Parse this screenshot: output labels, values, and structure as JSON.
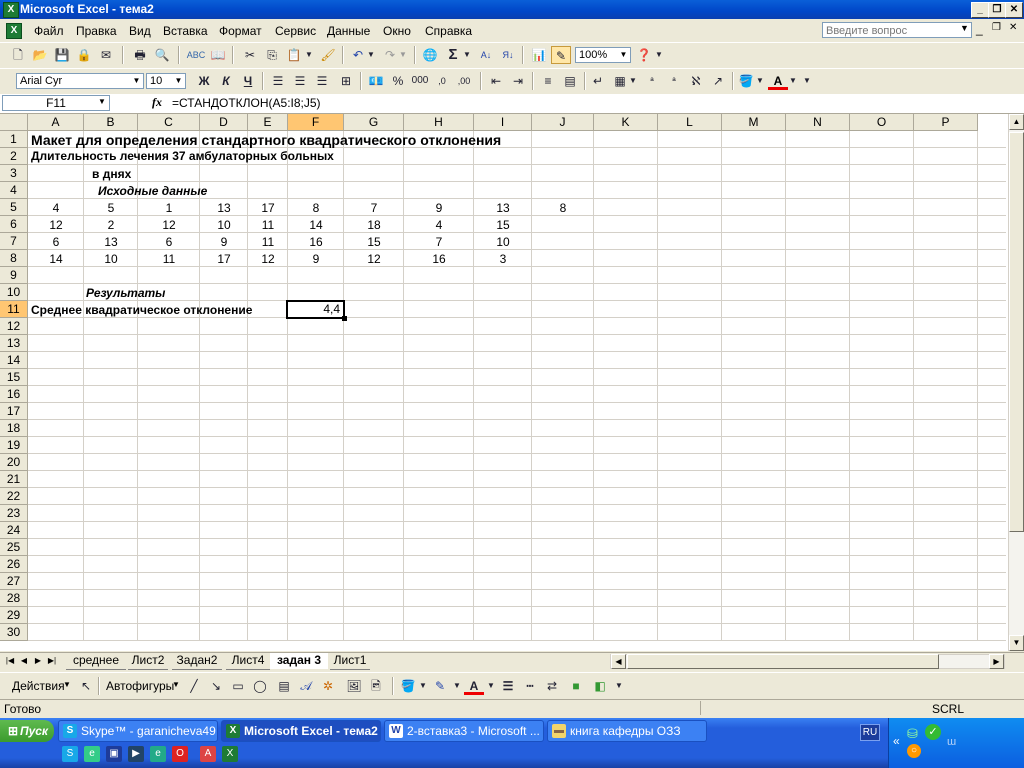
{
  "window": {
    "title": "Microsoft Excel - тема2"
  },
  "menu": {
    "items": [
      "Файл",
      "Правка",
      "Вид",
      "Вставка",
      "Формат",
      "Сервис",
      "Данные",
      "Окно",
      "Справка"
    ],
    "ask_placeholder": "Введите вопрос"
  },
  "toolbar": {
    "zoom": "100%"
  },
  "format_toolbar": {
    "font": "Arial Cyr",
    "size": "10",
    "bold": "Ж",
    "italic": "К",
    "underline": "Ч",
    "percent": "%",
    "thousands": "000"
  },
  "formula_bar": {
    "name_box": "F11",
    "fx": "fx",
    "formula": "=СТАНДОТКЛОН(A5:I8;J5)"
  },
  "grid": {
    "columns": [
      "A",
      "B",
      "C",
      "D",
      "E",
      "F",
      "G",
      "H",
      "I",
      "J",
      "K",
      "L",
      "M",
      "N",
      "O",
      "P"
    ],
    "rows": [
      "1",
      "2",
      "3",
      "4",
      "5",
      "6",
      "7",
      "8",
      "9",
      "10",
      "11",
      "12",
      "13",
      "14",
      "15",
      "16",
      "17",
      "18",
      "19",
      "20",
      "21",
      "22",
      "23",
      "24",
      "25",
      "26",
      "27",
      "28",
      "29",
      "30"
    ],
    "texts": {
      "title": "Макет для определения стандартного квадратического отклонения",
      "subtitle": "Длительность лечения 37 амбулаторных больных",
      "units": "в днях",
      "source": "Исходные данные",
      "results": "Результаты",
      "stdev_label": "Среднее квадратическое отклонение",
      "stdev_value": "4,4"
    },
    "data": [
      [
        "4",
        "5",
        "1",
        "13",
        "17",
        "8",
        "7",
        "9",
        "13",
        "8"
      ],
      [
        "12",
        "2",
        "12",
        "10",
        "11",
        "14",
        "18",
        "4",
        "15"
      ],
      [
        "6",
        "13",
        "6",
        "9",
        "11",
        "16",
        "15",
        "7",
        "10"
      ],
      [
        "14",
        "10",
        "11",
        "17",
        "12",
        "9",
        "12",
        "16",
        "3"
      ]
    ]
  },
  "sheets": {
    "tabs": [
      "среднее",
      "Лист2",
      "Задан2",
      "Лист4",
      "задан 3",
      "Лист1"
    ],
    "active_index": 4
  },
  "drawing": {
    "actions": "Действия",
    "autoshapes": "Автофигуры"
  },
  "status": {
    "left": "Готово",
    "scrl": "SCRL"
  },
  "taskbar": {
    "start": "Пуск",
    "tasks": [
      "Skype™ - garanicheva49",
      "Microsoft Excel - тема2",
      "2-вставка3 - Microsoft ...",
      "книга кафедры ОЗЗ"
    ],
    "lang": "RU"
  },
  "colors": {
    "selection": "#FFC672",
    "title_bar": "#0A5FD8",
    "taskbar": "#245EDC"
  }
}
